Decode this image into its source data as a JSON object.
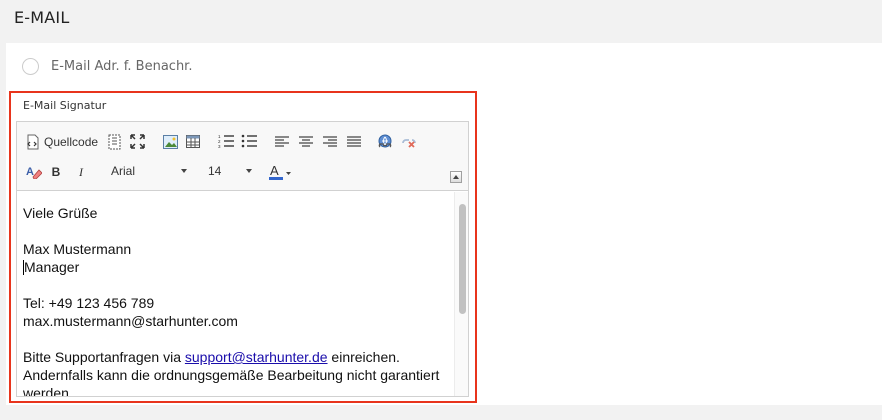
{
  "section": {
    "title": "E-MAIL"
  },
  "notify": {
    "label": "E-Mail Adr. f. Benachr.",
    "checked": false
  },
  "signature": {
    "label": "E-Mail Signatur",
    "toolbar": {
      "source_label": "Quellcode",
      "font_family": "Arial",
      "font_size": "14",
      "icons": [
        "source-icon",
        "show-blocks-icon",
        "maximize-icon",
        "image-icon",
        "table-icon",
        "numbered-list-icon",
        "bulleted-list-icon",
        "align-left-icon",
        "align-center-icon",
        "align-right-icon",
        "align-justify-icon",
        "link-icon",
        "unlink-icon",
        "remove-format-icon",
        "bold-icon",
        "italic-icon",
        "text-color-icon",
        "collapse-toolbar-icon"
      ],
      "text_color": "#3366cc"
    },
    "content": {
      "line1": "Viele Grüße",
      "line2": "Max Mustermann",
      "line3": "Manager",
      "line4": "Tel: +49 123 456 789",
      "line5": "max.mustermann@starhunter.com",
      "line6_before": "Bitte Supportanfragen via ",
      "line6_link": "support@starhunter.de",
      "line6_after": " einreichen.",
      "line7": "Andernfalls kann die ordnungsgemäße Bearbeitung nicht garantiert",
      "line8": "werden."
    }
  },
  "colors": {
    "highlight_border": "#e8341c",
    "link": "#1a0dab"
  }
}
